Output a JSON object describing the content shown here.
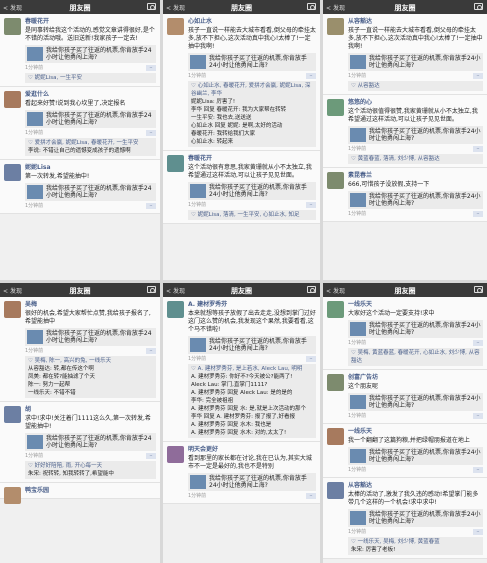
{
  "common": {
    "back": "发现",
    "title": "朋友圈",
    "link_text": "我给你孩子买了往返的机票,你肯放手24小时让他勇闯上海?",
    "time": "1分钟前"
  },
  "p1": [
    {
      "name": "春暖花开",
      "text": "是同事转给我这个活动的,感觉文章讲得很好,是个不错的活动哦。送旧送新!我家孩子一定去!",
      "comments": [
        "♡ 妮妮Lisa, 一生平安"
      ]
    },
    {
      "name": "爱逛什么",
      "text": "看起来好赞!说到我心坎里了,决定报名",
      "comments": [
        "♡ 爱拼才会赢, 妮妮Lisa, 春暖花开, 一生平安",
        "李说: 不错让自己的遗憾变成孩子的遗憾啊"
      ]
    },
    {
      "name": "妮妮Lisa",
      "text": "第一次转发,希望能抽中!",
      "comments": []
    }
  ],
  "p2": [
    {
      "name": "心如止水",
      "text": "孩子一直说一样能去大城市看看,倒父母的牵挂太多,放不下担心,这次活动真中我心!太棒了!一定抽中我啊!",
      "comments": [
        "♡ 心如止水, 春暖花开, 爱拼才会赢, 妮妮Lisa, 深谷幽兰, 李华",
        "妮妮Lisa: 厉害了!",
        "李华 回复 春暖花开: 我为大家帮在转转",
        "一生平安: 我也去,送送送",
        "心如止水 回复 妮妮: 是啊,太好的活动",
        "春暖花开: 我转给我们大家",
        "心如止水: 转起来"
      ]
    },
    {
      "name": "春暖花开",
      "text": "这个活动很有意思,我家黄珊就从小不太独立,我希望通过这样活动,可以让孩子见见世面。",
      "comments": [
        "♡ 妮妮Lisa, 落清, 一生平安, 心如止水, 知足"
      ]
    }
  ],
  "p3": [
    {
      "name": "从容豁达",
      "text": "孩子一直说一样能去大城市看看,倒父母的牵挂太多,放不下担心,这次活动真中我心!太棒了!一定抽中我啊!",
      "comments": [
        "♡ 从容豁达"
      ]
    },
    {
      "name": "悠悠的心",
      "text": "这个活动很值得很赞,我家黄珊就从小不太独立,我希望通过这样活动,可以让孩子见见世面。",
      "comments": [
        "♡ 黄蓝春蓝, 落清, 刘少博, 从容豁达"
      ]
    },
    {
      "name": "素昆春兰",
      "text": "666,可惜孩子没放假,支持一下",
      "comments": []
    }
  ],
  "p4": [
    {
      "name": "吴梅",
      "text": "很好的机会,希望大家帮忙点赞,我给孩子报名了,希望能抽中",
      "comments": [
        "♡ 吴梅, 陈一, 高兴的兔, 一线乐天",
        "从容豁达: 转,都在传这个啊",
        "凤美: 都在转?能抽滤了个天",
        "陈一: 努力一起帮",
        "一线乐天: 不错不错"
      ]
    },
    {
      "name": "胡",
      "text": "求中!求中!关注着门1111这么久,第一次转发,希望能抽中!",
      "comments": [
        "♡ 好好好陪陪, 雨, 开心每一天",
        "朱宋: 祝转转, 知我转转了,希望能中"
      ]
    },
    {
      "name": "鸭宝乐园",
      "text": "",
      "comments": []
    }
  ],
  "p5": [
    {
      "name": "A. 建材罗秀芬",
      "text": "本来就想等孩子放假了出去走走,没想到掌门过好这门这么赞的机会,我发现这个果然,我要看看,这个马不错啦!",
      "comments": [
        "♡ A. 建材罗秀芬, 是上若水, Aleck Lau, 明明",
        "A. 建材罗秀芬: 你好不?今天被公?能两了!",
        "Aleck Lau: 掌门,直掌门1111?",
        "A. 建材罗秀芬 回复 Aleck Lau: 是的是的",
        "李华: 完全被祖祖",
        "A. 建材罗秀芬 回复 水: 是,就是上次活动的那个",
        "李华 回复 A. 建材罗秀芬: 报了报了,好看报",
        "A. 建材罗秀芬 回复 水木: 我也是",
        "A. 建材罗秀芬 回复 水木: 对的,太太了!"
      ]
    },
    {
      "name": "明天会更好",
      "text": "看到那里的家长都在讨论,我在已认为,其实大城市不一定是最好的,我也不是特别",
      "comments": []
    }
  ],
  "p6": [
    {
      "name": "一线乐天",
      "text": "大家好这个活动一定要支持!求中",
      "comments": [
        "♡ 吴梅, 黄蓝春蓝, 春暖花开, 心如止水, 刘少博, 从容豁达"
      ]
    },
    {
      "name": "创富广告坊",
      "text": "这个朋友呢",
      "comments": []
    },
    {
      "name": "一线乐天",
      "text": "我一个翻翻了这篇狗粮,并把绿帽朋报道在地上",
      "comments": []
    },
    {
      "name": "从容豁达",
      "text": "太棒的活动了,激发了我久违的感动!希望掌门能多带几个这样的一个机会!求中求中!",
      "comments": [
        "♡ 一线乐天, 吴梅, 刘少博, 黄蓝春蓝",
        "朱宋: 厉害了老板!"
      ]
    }
  ]
}
